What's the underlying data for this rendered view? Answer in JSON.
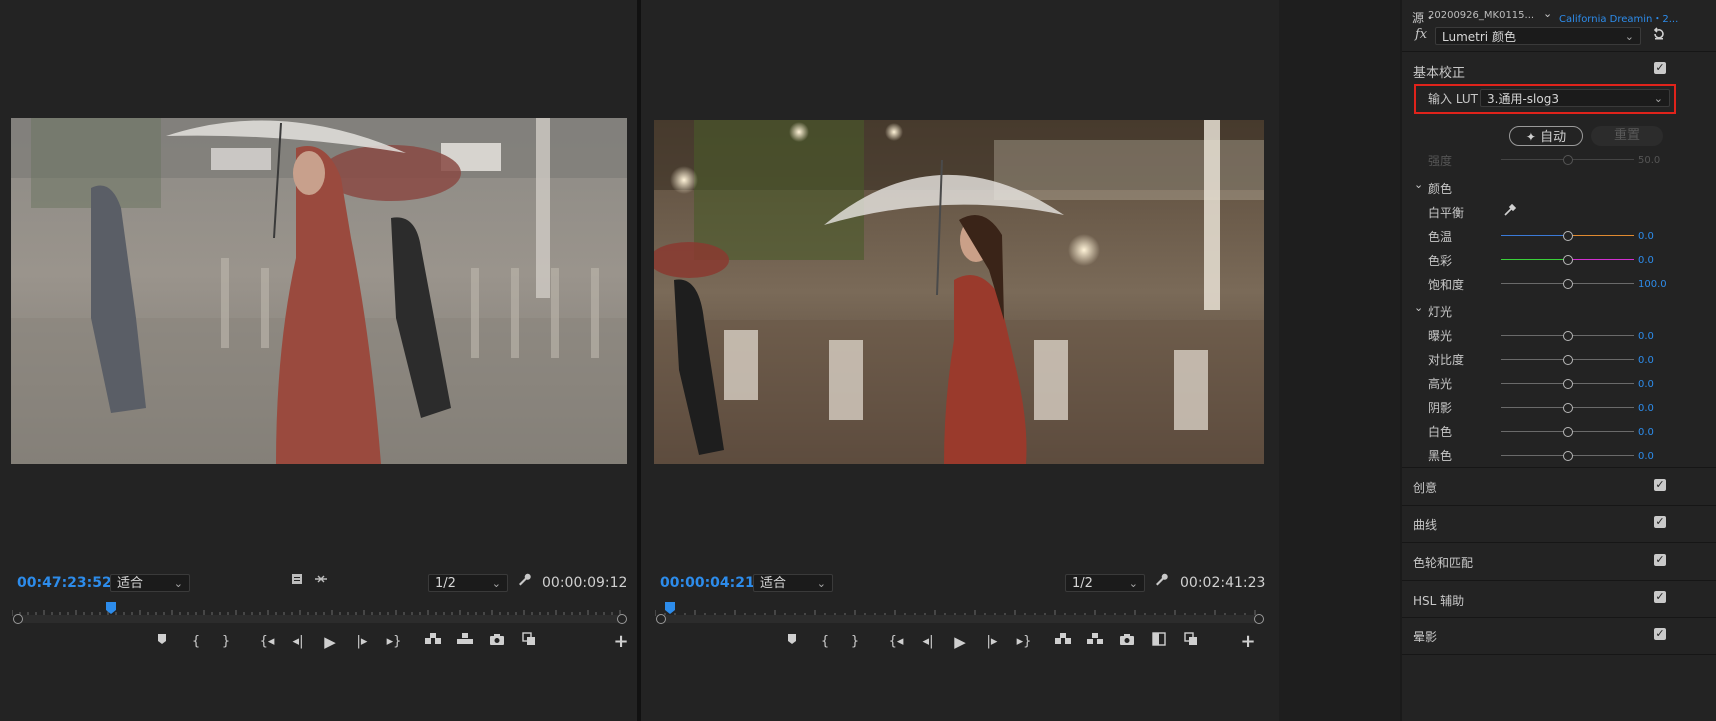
{
  "source_monitor": {
    "timecode_current": "00:47:23:52",
    "fit_select": "适合",
    "resolution_select": "1/2",
    "timecode_duration": "00:00:09:12"
  },
  "program_monitor": {
    "timecode_current": "00:00:04:21",
    "fit_select": "适合",
    "resolution_select": "1/2",
    "timecode_duration": "00:02:41:23"
  },
  "lumetri": {
    "source_prefix": "源・",
    "source_clip": "20200926_MK0115...",
    "sequence_clip": "California Dreamin・2...",
    "fx_label": "fx",
    "effect_select": "Lumetri 颜色",
    "basic_correction": {
      "title": "基本校正",
      "input_lut_label": "输入 LUT",
      "input_lut_value": "3.通用-slog3",
      "auto_button": "自动",
      "reset_button": "重置",
      "intensity_label": "强度",
      "intensity_value": "50.0",
      "color_group": "颜色",
      "white_balance_label": "白平衡",
      "temperature_label": "色温",
      "temperature_value": "0.0",
      "tint_label": "色彩",
      "tint_value": "0.0",
      "saturation_label": "饱和度",
      "saturation_value": "100.0",
      "light_group": "灯光",
      "exposure_label": "曝光",
      "exposure_value": "0.0",
      "contrast_label": "对比度",
      "contrast_value": "0.0",
      "highlights_label": "高光",
      "highlights_value": "0.0",
      "shadows_label": "阴影",
      "shadows_value": "0.0",
      "whites_label": "白色",
      "whites_value": "0.0",
      "blacks_label": "黑色",
      "blacks_value": "0.0"
    },
    "sections": [
      {
        "label": "创意"
      },
      {
        "label": "曲线"
      },
      {
        "label": "色轮和匹配"
      },
      {
        "label": "HSL 辅助"
      },
      {
        "label": "晕影"
      }
    ]
  },
  "colors": {
    "accent_blue": "#2d8ceb",
    "highlight_red": "#e0231b"
  }
}
